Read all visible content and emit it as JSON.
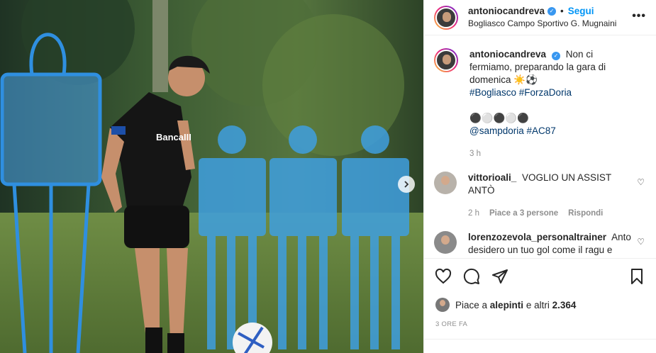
{
  "photo": {
    "alt": "",
    "sponsor_text": "BancaIII",
    "next_label": "›"
  },
  "header": {
    "username": "antoniocandreva",
    "verified_mark": "✓",
    "separator": "•",
    "follow_label": "Segui",
    "location": "Bogliasco Campo Sportivo G. Mugnaini",
    "more_label": "•••"
  },
  "caption": {
    "username": "antoniocandreva",
    "text": "Non ci fermiamo, preparando la gara di domenica ☀️⚽️",
    "tags_line1": "#Bogliasco #ForzaDoria",
    "emoji_line": "⚫⚪⚫⚪⚫",
    "tags_line2": "@sampdoria #AC87",
    "time": "3 h"
  },
  "comments": [
    {
      "username": "vittorioali_",
      "text": "VOGLIO UN ASSIST ANTÒ",
      "time": "2 h",
      "likes": "Piace a 3 persone",
      "reply": "Rispondi"
    },
    {
      "username": "lorenzozevola_personaltrainer",
      "text": "Anto desidero un tuo gol come il ragu e",
      "time": "",
      "likes": "",
      "reply": ""
    }
  ],
  "actions": {
    "like": "heart-icon",
    "comment": "comment-icon",
    "share": "share-icon",
    "save": "bookmark-icon"
  },
  "likes": {
    "prefix": "Piace a",
    "user": "alepinti",
    "middle": "e altri",
    "count": "2.364"
  },
  "timestamp": "3 ORE FA",
  "colors": {
    "accent": "#0095f6",
    "verified": "#3897f0",
    "text": "#262626",
    "muted": "#8e8e8e",
    "dummy_blue": "#3f9fe0"
  }
}
